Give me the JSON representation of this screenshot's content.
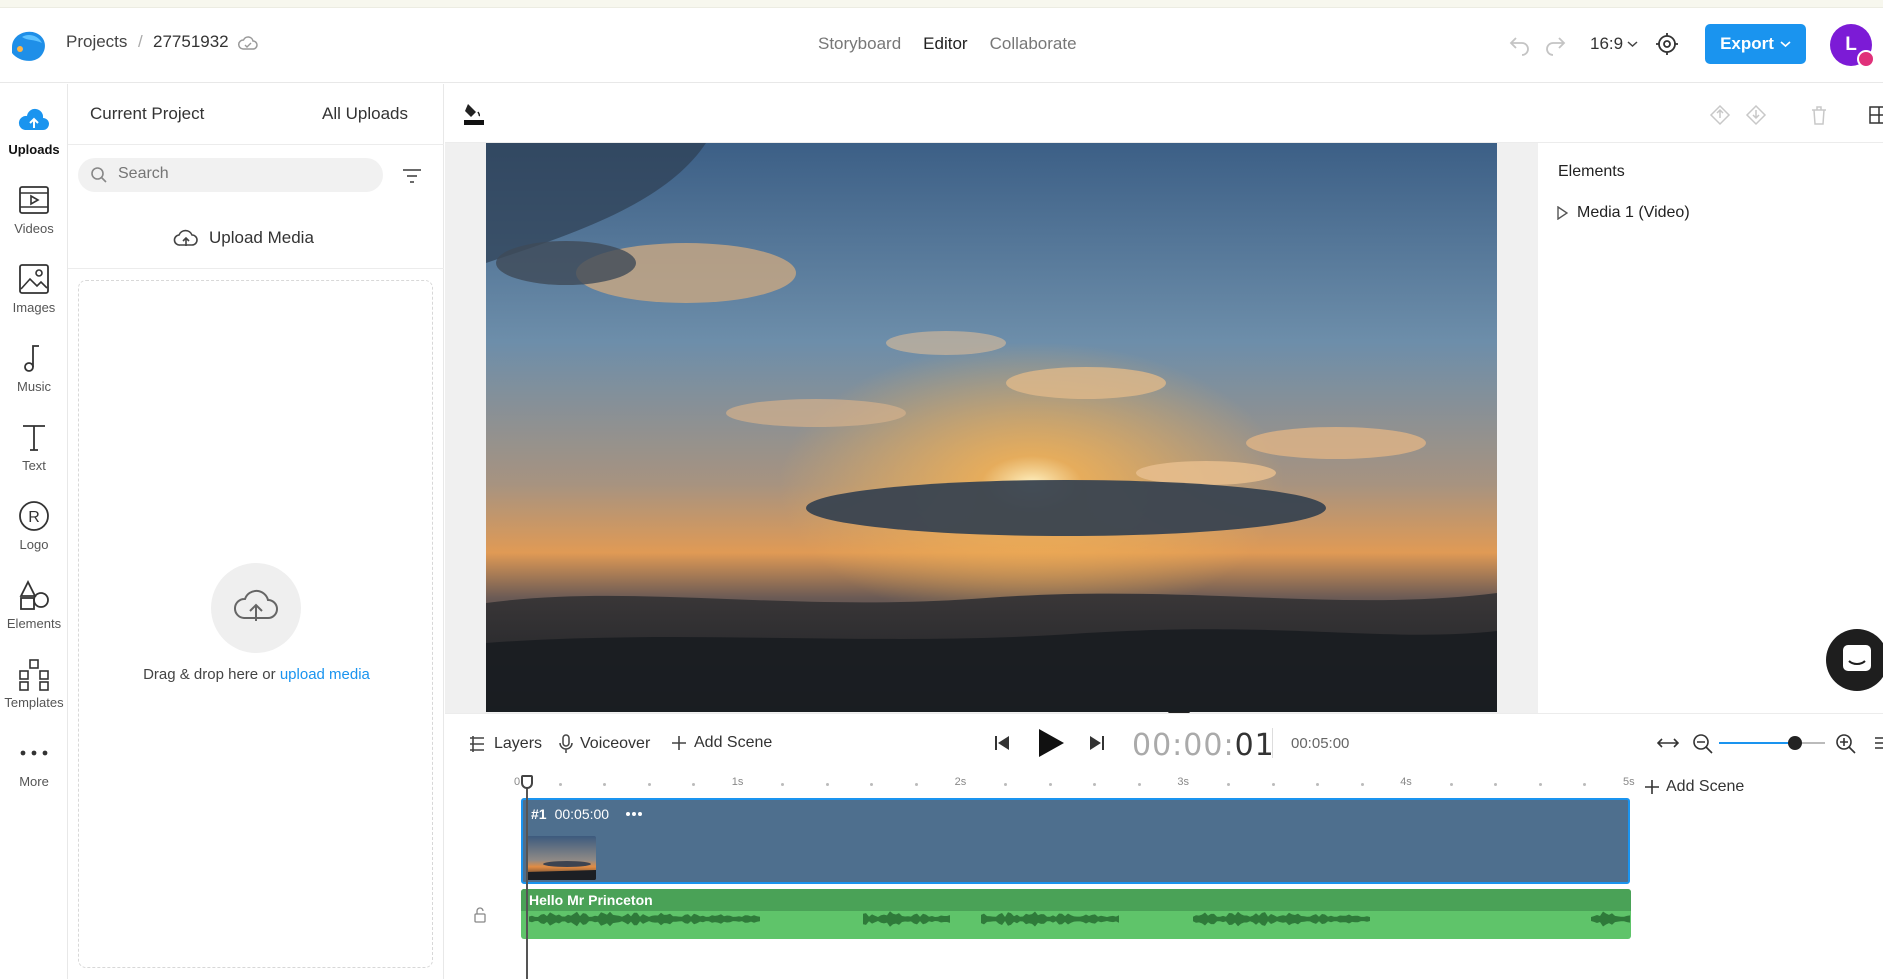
{
  "header": {
    "breadcrumb_root": "Projects",
    "breadcrumb_sep": "/",
    "project_id": "27751932",
    "tabs": [
      {
        "label": "Storyboard"
      },
      {
        "label": "Editor"
      },
      {
        "label": "Collaborate"
      }
    ],
    "aspect_ratio": "16:9",
    "export_label": "Export",
    "avatar_initial": "L",
    "accent_color": "#1a94ef",
    "avatar_color": "#7c1bd6"
  },
  "rail": {
    "items": [
      {
        "label": "Uploads",
        "icon": "cloud-upload-icon"
      },
      {
        "label": "Videos",
        "icon": "video-icon"
      },
      {
        "label": "Images",
        "icon": "image-icon"
      },
      {
        "label": "Music",
        "icon": "music-note-icon"
      },
      {
        "label": "Text",
        "icon": "text-icon"
      },
      {
        "label": "Logo",
        "icon": "logo-icon"
      },
      {
        "label": "Elements",
        "icon": "shapes-icon"
      },
      {
        "label": "Templates",
        "icon": "templates-icon"
      },
      {
        "label": "More",
        "icon": "more-icon"
      }
    ]
  },
  "panel": {
    "tab_current": "Current Project",
    "tab_all": "All Uploads",
    "search_placeholder": "Search",
    "upload_label": "Upload Media",
    "drop_text": "Drag & drop here or ",
    "drop_link": "upload media"
  },
  "elements": {
    "title": "Elements",
    "items": [
      {
        "label": "Media 1 (Video)"
      }
    ]
  },
  "timeline": {
    "layers_label": "Layers",
    "voiceover_label": "Voiceover",
    "add_scene_label": "Add Scene",
    "timecode_prefix": "00:00:",
    "timecode_current": "01",
    "total_duration": "00:05:00",
    "ruler_labels": [
      "0",
      "1s",
      "2s",
      "3s",
      "4s",
      "5s"
    ],
    "scene": {
      "number": "#1",
      "duration": "00:05:00"
    },
    "audio_track_name": "Hello Mr Princeton",
    "add_scene_right": "Add Scene",
    "zoom_level": 0.72
  }
}
